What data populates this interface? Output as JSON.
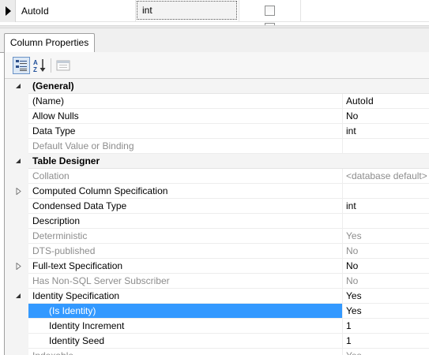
{
  "grid_row": {
    "column_name": "AutoId",
    "data_type": "int"
  },
  "tab": {
    "label": "Column Properties"
  },
  "properties": [
    {
      "kind": "category",
      "label": "(General)",
      "expanded": true
    },
    {
      "label": "(Name)",
      "value": "AutoId"
    },
    {
      "label": "Allow Nulls",
      "value": "No"
    },
    {
      "label": "Data Type",
      "value": "int"
    },
    {
      "label": "Default Value or Binding",
      "value": "",
      "dim": true
    },
    {
      "kind": "category",
      "label": "Table Designer",
      "expanded": true
    },
    {
      "label": "Collation",
      "value": "<database default>",
      "dim": true
    },
    {
      "label": "Computed Column Specification",
      "value": "",
      "expandable": true
    },
    {
      "label": "Condensed Data Type",
      "value": "int"
    },
    {
      "label": "Description",
      "value": ""
    },
    {
      "label": "Deterministic",
      "value": "Yes",
      "dim": true
    },
    {
      "label": "DTS-published",
      "value": "No",
      "dim": true
    },
    {
      "label": "Full-text Specification",
      "value": "No",
      "expandable": true
    },
    {
      "label": "Has Non-SQL Server Subscriber",
      "value": "No",
      "dim": true
    },
    {
      "label": "Identity Specification",
      "value": "Yes",
      "expandable": true,
      "expanded": true
    },
    {
      "label": "(Is Identity)",
      "value": "Yes",
      "child": true,
      "selected": true
    },
    {
      "label": "Identity Increment",
      "value": "1",
      "child": true
    },
    {
      "label": "Identity Seed",
      "value": "1",
      "child": true
    },
    {
      "label": "Indexable",
      "value": "Yes",
      "dim": true
    }
  ],
  "colors": {
    "selection": "#3399ff",
    "dim_text": "#8d8d8d",
    "gutter": "#f4f4f4"
  }
}
